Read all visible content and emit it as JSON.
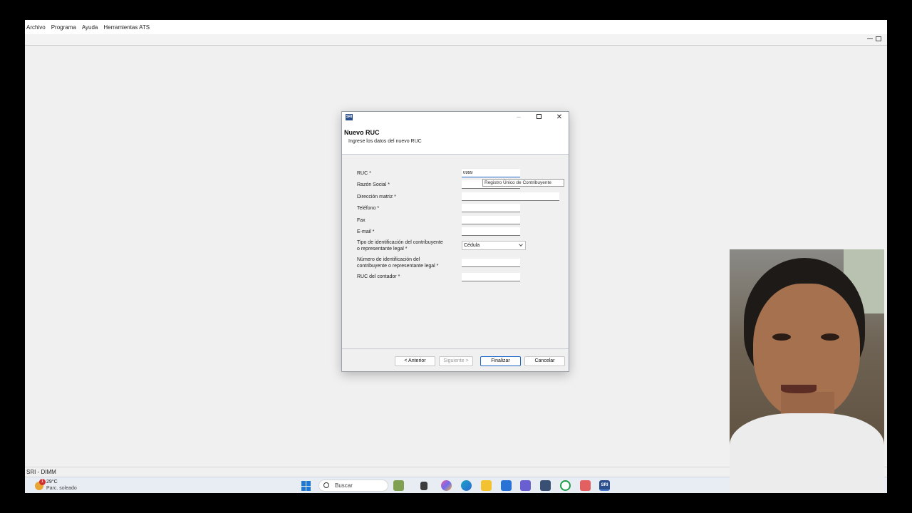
{
  "menubar": {
    "items": [
      "Archivo",
      "Programa",
      "Ayuda",
      "Herramientas ATS"
    ]
  },
  "statusbar": {
    "text": "SRI - DIMM"
  },
  "taskbar": {
    "weather_temp": "29°C",
    "weather_condition": "Parc. soleado",
    "weather_badge": "1",
    "search_placeholder": "Buscar",
    "sri_app_label": "SRI"
  },
  "dialog": {
    "icon_label": "SRI",
    "title": "Nuevo RUC",
    "subtitle": "Ingrese los datos del nuevo RUC",
    "fields": {
      "ruc_label": "RUC *",
      "ruc_value": "0999",
      "razon_social_label": "Razón Social *",
      "direccion_label": "Dirección matriz *",
      "telefono_label": "Teléfono *",
      "fax_label": "Fax",
      "email_label": "E-mail *",
      "tipo_id_label_line1": "Tipo de identificación del contribuyente",
      "tipo_id_label_line2": "o representante legal *",
      "tipo_id_value": "Cédula",
      "numero_id_label_line1": "Número de identificación del",
      "numero_id_label_line2": "contribuyente o representante legal *",
      "ruc_contador_label": "RUC del contador *"
    },
    "tooltip": "Registro Único de Contribuyente",
    "buttons": {
      "back": "< Anterior",
      "next": "Siguiente >",
      "finish": "Finalizar",
      "cancel": "Cancelar"
    }
  },
  "colors": {
    "accent": "#1b66c9",
    "sri_brand": "#2a4e8c"
  },
  "icons": {
    "taskbar": [
      "weather-icon",
      "windows-start-icon",
      "search-icon",
      "widgets-icon",
      "files-icon",
      "copilot-icon",
      "edge-icon",
      "folder-icon",
      "mail-icon",
      "teams-icon",
      "store-icon",
      "whatsapp-icon",
      "snipping-icon",
      "sri-app-icon"
    ]
  }
}
